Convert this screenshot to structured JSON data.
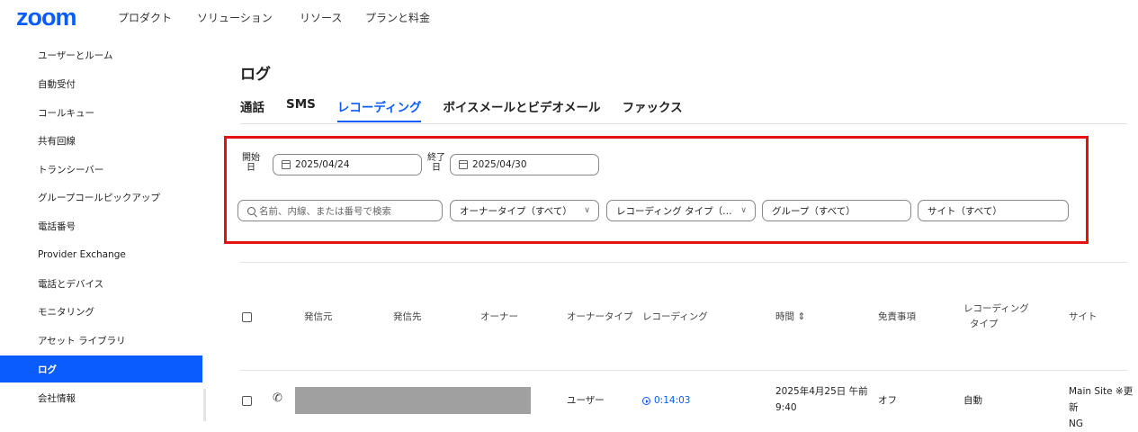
{
  "topnav": {
    "logo": "zoom",
    "items": [
      "プロダクト",
      "ソリューション",
      "リソース",
      "プランと料金"
    ]
  },
  "sidebar": {
    "items": [
      {
        "label": "ユーザーとルーム",
        "active": false
      },
      {
        "label": "自動受付",
        "active": false
      },
      {
        "label": "コールキュー",
        "active": false
      },
      {
        "label": "共有回線",
        "active": false
      },
      {
        "label": "トランシーバー",
        "active": false
      },
      {
        "label": "グループコールピックアップ",
        "active": false
      },
      {
        "label": "電話番号",
        "active": false
      },
      {
        "label": "Provider Exchange",
        "active": false
      },
      {
        "label": "電話とデバイス",
        "active": false
      },
      {
        "label": "モニタリング",
        "active": false
      },
      {
        "label": "アセット ライブラリ",
        "active": false
      },
      {
        "label": "ログ",
        "active": true
      },
      {
        "label": "会社情報",
        "active": false
      }
    ]
  },
  "page": {
    "title": "ログ"
  },
  "tabs": [
    {
      "label": "通話",
      "active": false
    },
    {
      "label": "SMS",
      "active": false
    },
    {
      "label": "レコーディング",
      "active": true
    },
    {
      "label": "ボイスメールとビデオメール",
      "active": false
    },
    {
      "label": "ファックス",
      "active": false
    }
  ],
  "filters": {
    "start_label": "開始日",
    "start_date": "2025/04/24",
    "end_label": "終了日",
    "end_date": "2025/04/30",
    "search_placeholder": "名前、内線、または番号で検索",
    "owner_type": "オーナータイプ（すべて）",
    "recording_type": "レコーディング タイプ（…",
    "group": "グループ（すべて）",
    "site": "サイト（すべて）"
  },
  "table": {
    "headers": {
      "from": "発信元",
      "to": "発信先",
      "owner": "オーナー",
      "owner_type": "オーナータイプ",
      "recording": "レコーディング",
      "time": "時間 ⇕",
      "disclaimer": "免責事項",
      "recording_type_1": "レコーディング",
      "recording_type_2": "タイプ",
      "site": "サイト"
    },
    "rows": [
      {
        "owner_type": "ユーザー",
        "recording": "0:14:03",
        "time_1": "2025年4月25日 午前",
        "time_2": "9:40",
        "disclaimer": "オフ",
        "recording_type": "自動",
        "site_1": "Main Site ※更新",
        "site_2": "NG"
      }
    ]
  },
  "colors": {
    "brand": "#0b5cff",
    "highlight": "#e31111"
  },
  "icons": [
    "calendar-icon",
    "search-icon",
    "chevron-down-icon",
    "phone-icon",
    "play-icon"
  ]
}
